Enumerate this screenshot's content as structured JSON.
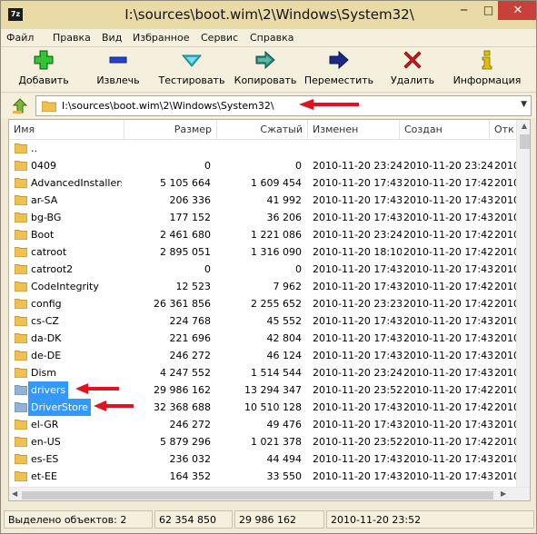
{
  "window": {
    "icon_label": "7z",
    "title": "I:\\sources\\boot.wim\\2\\Windows\\System32\\",
    "minimize_glyph": "─",
    "maximize_glyph": "□",
    "close_glyph": "✕"
  },
  "menu": [
    "Файл",
    "Правка",
    "Вид",
    "Избранное",
    "Сервис",
    "Справка"
  ],
  "toolbar": [
    {
      "label": "Добавить",
      "icon": "add-icon",
      "color": "#22aa22"
    },
    {
      "label": "Извлечь",
      "icon": "extract-icon",
      "color": "#2244cc"
    },
    {
      "label": "Тестировать",
      "icon": "test-icon",
      "color": "#2bb3c9"
    },
    {
      "label": "Копировать",
      "icon": "copy-icon",
      "color": "#2a8a7a"
    },
    {
      "label": "Переместить",
      "icon": "move-icon",
      "color": "#1a2a8a"
    },
    {
      "label": "Удалить",
      "icon": "delete-icon",
      "color": "#d01818"
    },
    {
      "label": "Информация",
      "icon": "info-icon",
      "color": "#c8a800"
    }
  ],
  "address": {
    "path": "I:\\sources\\boot.wim\\2\\Windows\\System32\\"
  },
  "columns": [
    "Имя",
    "Размер",
    "Сжатый",
    "Изменен",
    "Создан",
    "Отк"
  ],
  "rows": [
    {
      "name": "..",
      "size": "",
      "packed": "",
      "modified": "",
      "created": "",
      "accessed": "",
      "selected": false
    },
    {
      "name": "0409",
      "size": "0",
      "packed": "0",
      "modified": "2010-11-20 23:24",
      "created": "2010-11-20 23:24",
      "accessed": "2010-",
      "selected": false
    },
    {
      "name": "AdvancedInstallers",
      "size": "5 105 664",
      "packed": "1 609 454",
      "modified": "2010-11-20 17:43",
      "created": "2010-11-20 17:42",
      "accessed": "2010-",
      "selected": false
    },
    {
      "name": "ar-SA",
      "size": "206 336",
      "packed": "41 992",
      "modified": "2010-11-20 17:43",
      "created": "2010-11-20 17:43",
      "accessed": "2010-",
      "selected": false
    },
    {
      "name": "bg-BG",
      "size": "177 152",
      "packed": "36 206",
      "modified": "2010-11-20 17:43",
      "created": "2010-11-20 17:43",
      "accessed": "2010-",
      "selected": false
    },
    {
      "name": "Boot",
      "size": "2 461 680",
      "packed": "1 221 086",
      "modified": "2010-11-20 23:24",
      "created": "2010-11-20 17:42",
      "accessed": "2010-",
      "selected": false
    },
    {
      "name": "catroot",
      "size": "2 895 051",
      "packed": "1 316 090",
      "modified": "2010-11-20 18:10",
      "created": "2010-11-20 17:42",
      "accessed": "2010-",
      "selected": false
    },
    {
      "name": "catroot2",
      "size": "0",
      "packed": "0",
      "modified": "2010-11-20 17:43",
      "created": "2010-11-20 17:43",
      "accessed": "2010-",
      "selected": false
    },
    {
      "name": "CodeIntegrity",
      "size": "12 523",
      "packed": "7 962",
      "modified": "2010-11-20 17:43",
      "created": "2010-11-20 17:42",
      "accessed": "2010-",
      "selected": false
    },
    {
      "name": "config",
      "size": "26 361 856",
      "packed": "2 255 652",
      "modified": "2010-11-20 23:23",
      "created": "2010-11-20 17:42",
      "accessed": "2010-",
      "selected": false
    },
    {
      "name": "cs-CZ",
      "size": "224 768",
      "packed": "45 552",
      "modified": "2010-11-20 17:43",
      "created": "2010-11-20 17:43",
      "accessed": "2010-",
      "selected": false
    },
    {
      "name": "da-DK",
      "size": "221 696",
      "packed": "42 804",
      "modified": "2010-11-20 17:43",
      "created": "2010-11-20 17:43",
      "accessed": "2010-",
      "selected": false
    },
    {
      "name": "de-DE",
      "size": "246 272",
      "packed": "46 124",
      "modified": "2010-11-20 17:43",
      "created": "2010-11-20 17:43",
      "accessed": "2010-",
      "selected": false
    },
    {
      "name": "Dism",
      "size": "4 247 552",
      "packed": "1 514 544",
      "modified": "2010-11-20 23:24",
      "created": "2010-11-20 17:43",
      "accessed": "2010-",
      "selected": false
    },
    {
      "name": "drivers",
      "size": "29 986 162",
      "packed": "13 294 347",
      "modified": "2010-11-20 23:52",
      "created": "2010-11-20 17:42",
      "accessed": "2010-",
      "selected": true
    },
    {
      "name": "DriverStore",
      "size": "32 368 688",
      "packed": "10 510 128",
      "modified": "2010-11-20 17:43",
      "created": "2010-11-20 17:42",
      "accessed": "2010-",
      "selected": true
    },
    {
      "name": "el-GR",
      "size": "246 272",
      "packed": "49 476",
      "modified": "2010-11-20 17:43",
      "created": "2010-11-20 17:43",
      "accessed": "2010-",
      "selected": false
    },
    {
      "name": "en-US",
      "size": "5 879 296",
      "packed": "1 021 378",
      "modified": "2010-11-20 23:52",
      "created": "2010-11-20 17:42",
      "accessed": "2010-",
      "selected": false
    },
    {
      "name": "es-ES",
      "size": "236 032",
      "packed": "44 494",
      "modified": "2010-11-20 17:43",
      "created": "2010-11-20 17:43",
      "accessed": "2010-",
      "selected": false
    },
    {
      "name": "et-EE",
      "size": "164 352",
      "packed": "33 550",
      "modified": "2010-11-20 17:43",
      "created": "2010-11-20 17:43",
      "accessed": "2010-",
      "selected": false
    }
  ],
  "status": {
    "selected_count": "Выделено объектов: 2",
    "total_size": "62 354 850",
    "total_packed": "29 986 162",
    "date": "2010-11-20 23:52"
  },
  "colors": {
    "selection": "#3399ff",
    "annotation_arrow": "#e0141e",
    "folder": "#f0c050",
    "title_bar": "#eadba6"
  }
}
